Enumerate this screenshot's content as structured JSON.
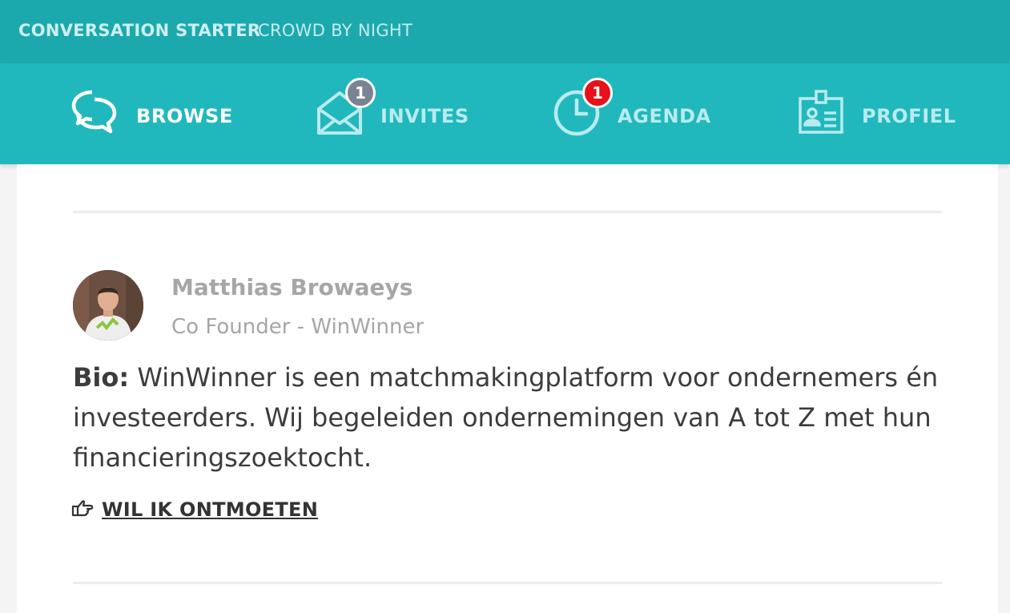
{
  "header": {
    "title": "CONVERSATION STARTER",
    "subtitle": "CROWD BY NIGHT"
  },
  "nav": {
    "items": [
      {
        "label": "BROWSE",
        "icon": "chat-bubbles-icon",
        "active": true
      },
      {
        "label": "INVITES",
        "icon": "envelope-icon",
        "badge": "1",
        "badge_color": "#7a8394"
      },
      {
        "label": "AGENDA",
        "icon": "clock-icon",
        "badge": "1",
        "badge_color": "#e8101a"
      },
      {
        "label": "PROFIEL",
        "icon": "id-card-icon"
      }
    ]
  },
  "profile": {
    "name": "Matthias Browaeys",
    "role": "Co Founder - WinWinner",
    "bio_label": "Bio:",
    "bio_text": " WinWinner is een matchmakingplatform voor ondernemers én investeerders. Wij begeleiden ondernemingen van A tot Z met hun financieringszoektocht.",
    "action_label": "WIL IK ONTMOETEN",
    "action_icon": "pointing-hand-icon"
  },
  "colors": {
    "header_bg": "#1ca9ae",
    "nav_bg": "#21b8bd",
    "badge_gray": "#7a8394",
    "badge_red": "#e8101a"
  }
}
